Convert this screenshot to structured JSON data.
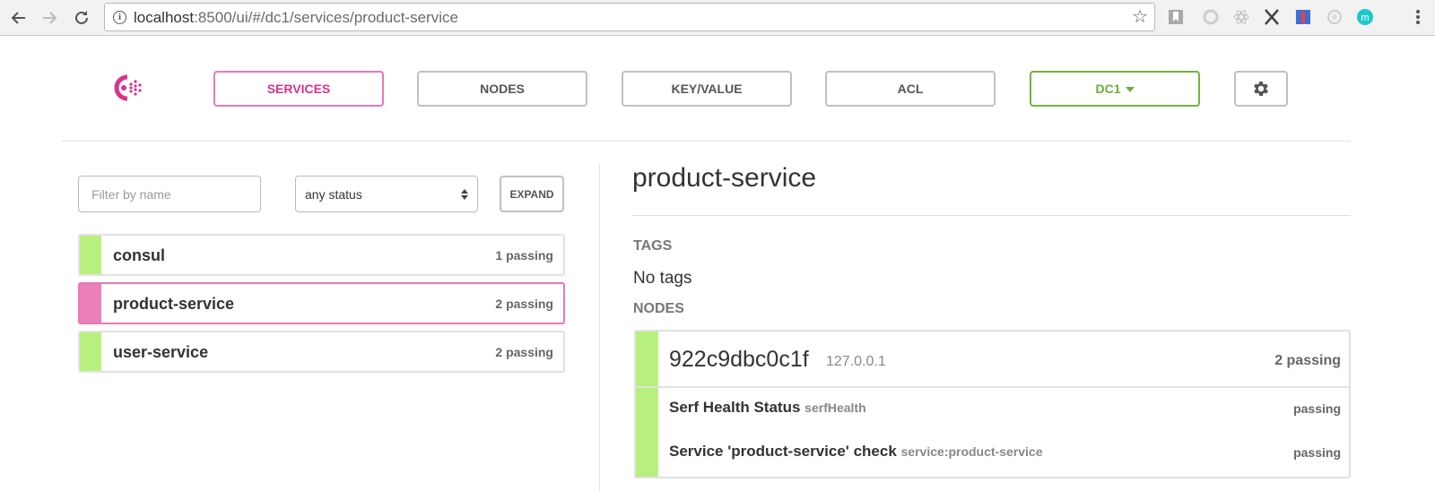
{
  "browser": {
    "url_host": "localhost",
    "url_rest": ":8500/ui/#/dc1/services/product-service"
  },
  "colors": {
    "accent_pink": "#d6338c",
    "healthy_green": "#b8f07e",
    "dc_green": "#6bae35"
  },
  "nav": {
    "services": "SERVICES",
    "nodes": "NODES",
    "key_value": "KEY/VALUE",
    "acl": "ACL",
    "datacenter": "DC1",
    "settings_icon": "gear-icon"
  },
  "filters": {
    "name_placeholder": "Filter by name",
    "name_value": "",
    "status_selected": "any status",
    "expand_label": "EXPAND"
  },
  "services": [
    {
      "name": "consul",
      "count": "1 passing",
      "status": "passing"
    },
    {
      "name": "product-service",
      "count": "2 passing",
      "status": "passing",
      "selected": true
    },
    {
      "name": "user-service",
      "count": "2 passing",
      "status": "passing"
    }
  ],
  "detail": {
    "title": "product-service",
    "tags_label": "TAGS",
    "tags_value": "No tags",
    "nodes_label": "NODES",
    "node": {
      "name": "922c9dbc0c1f",
      "address": "127.0.0.1",
      "count": "2 passing",
      "checks": [
        {
          "name": "Serf Health Status",
          "id": "serfHealth",
          "status": "passing"
        },
        {
          "name": "Service 'product-service' check",
          "id": "service:product-service",
          "status": "passing"
        }
      ]
    }
  }
}
